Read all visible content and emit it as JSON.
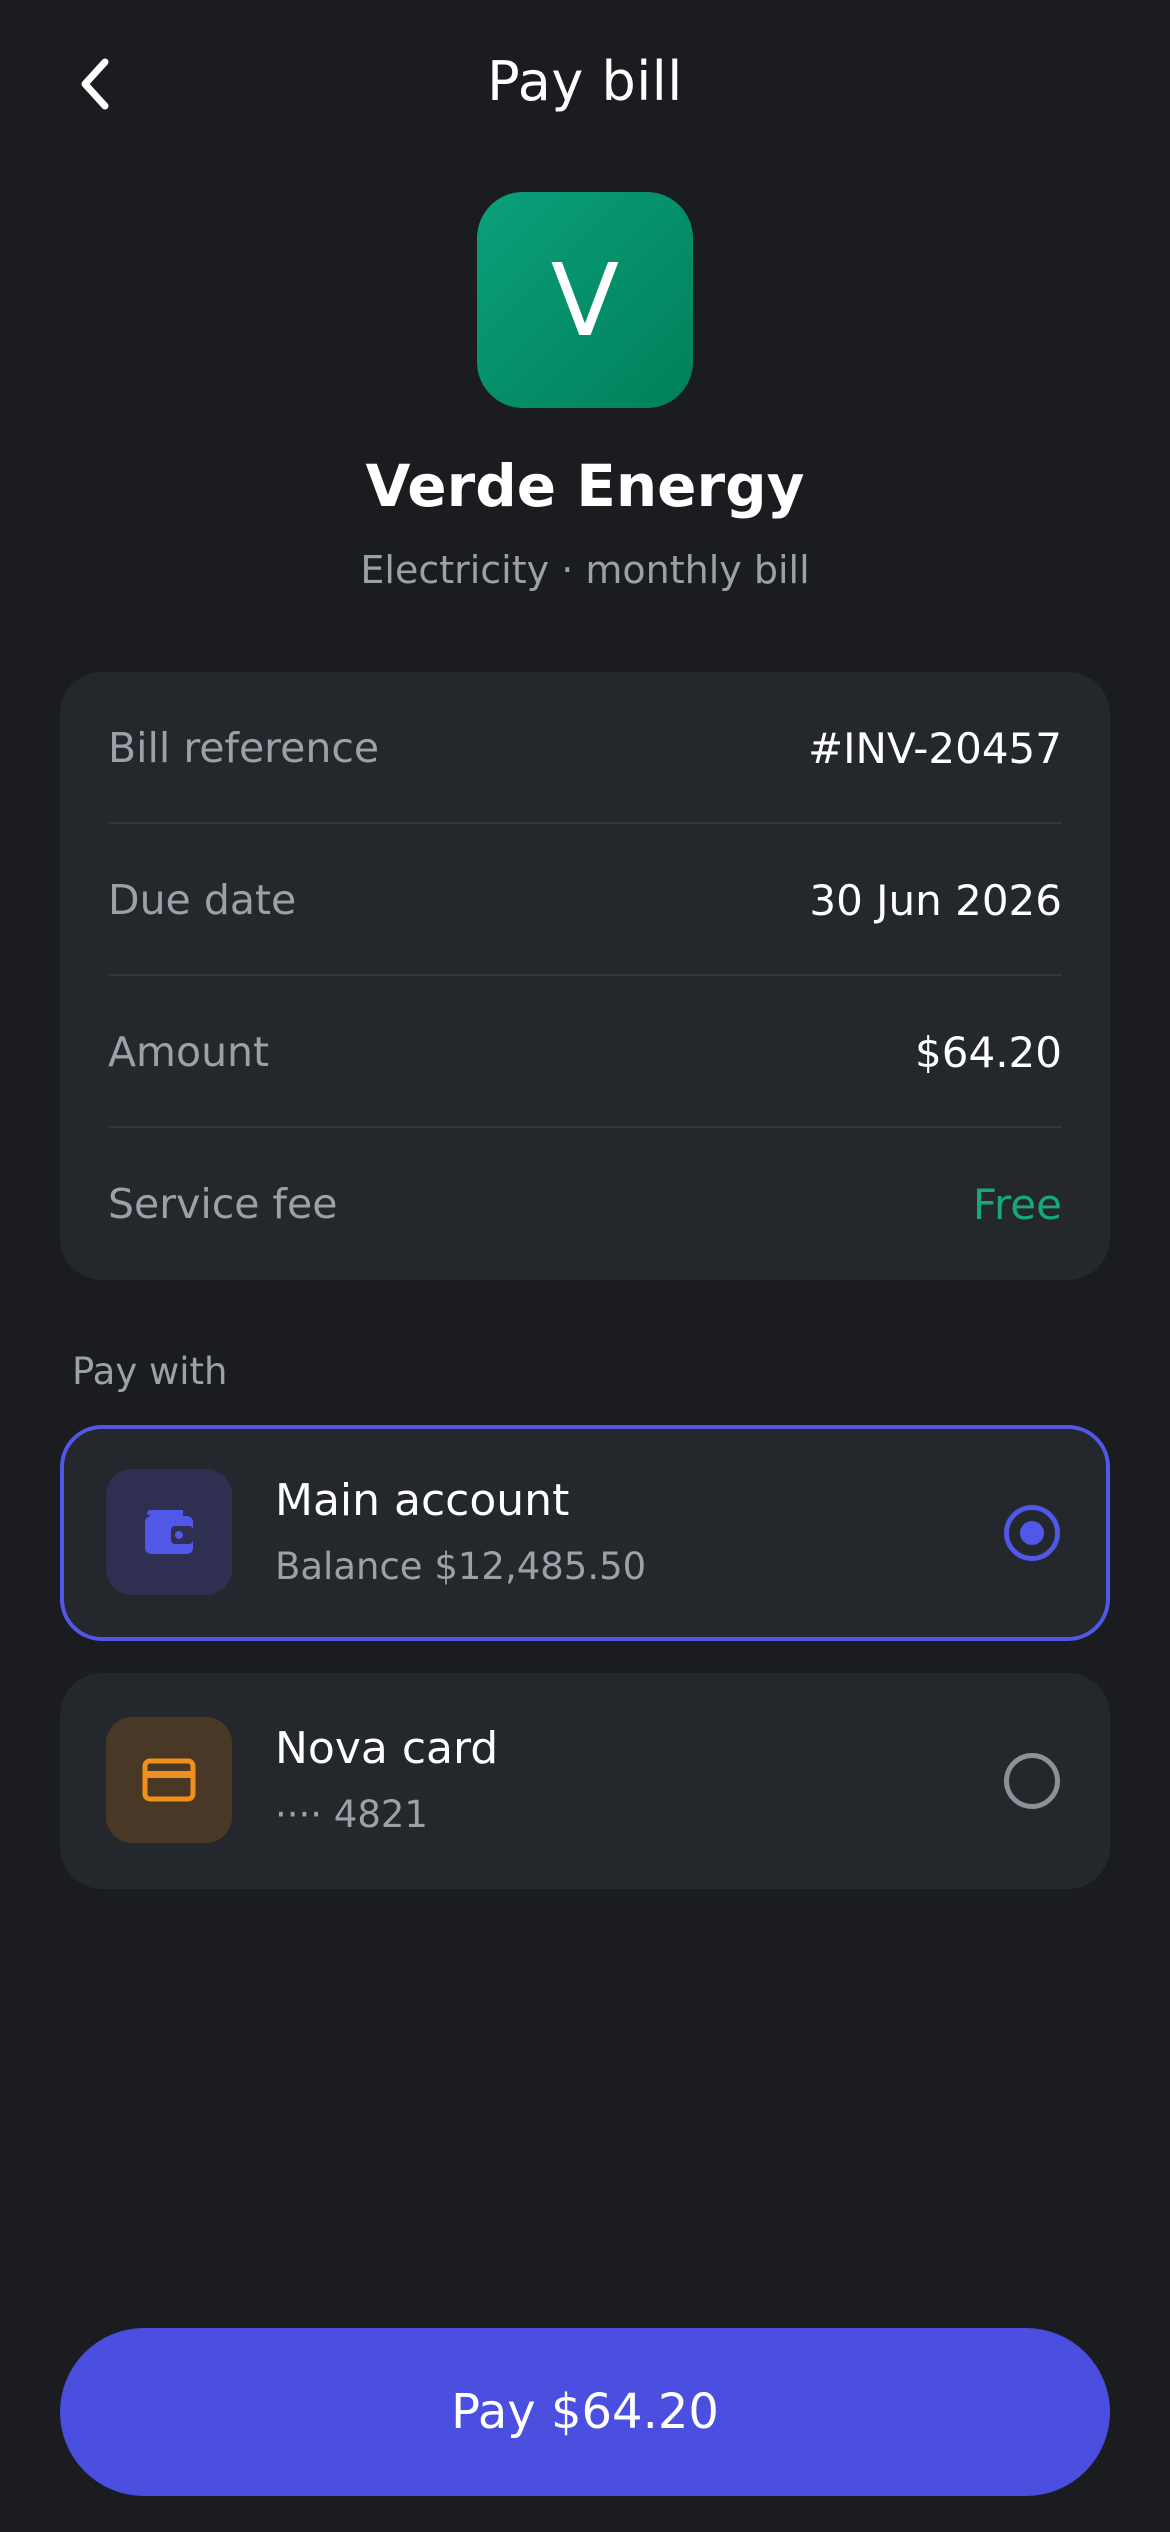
{
  "header": {
    "title": "Pay bill",
    "back_icon": "chevron-left-icon"
  },
  "merchant": {
    "initial": "V",
    "name": "Verde Energy",
    "subtitle": "Electricity · monthly bill",
    "logo_color": "#0a9a74"
  },
  "details": [
    {
      "label": "Bill reference",
      "value": "#INV-20457"
    },
    {
      "label": "Due date",
      "value": "30 Jun 2026"
    },
    {
      "label": "Amount",
      "value": "$64.20"
    },
    {
      "label": "Service fee",
      "value": "Free"
    }
  ],
  "pay_with": {
    "label": "Pay with",
    "methods": [
      {
        "name": "Main account",
        "detail": "Balance $12,485.50",
        "icon": "wallet-icon",
        "selected": true
      },
      {
        "name": "Nova card",
        "detail": "···· 4821",
        "icon": "credit-card-icon",
        "selected": false
      }
    ]
  },
  "pay_button": {
    "label": "Pay $64.20"
  },
  "colors": {
    "background": "#1a1c1f",
    "card": "#24272b",
    "accent": "#4a4fe0",
    "success": "#17a67d",
    "muted_text": "#9ca1a7"
  }
}
